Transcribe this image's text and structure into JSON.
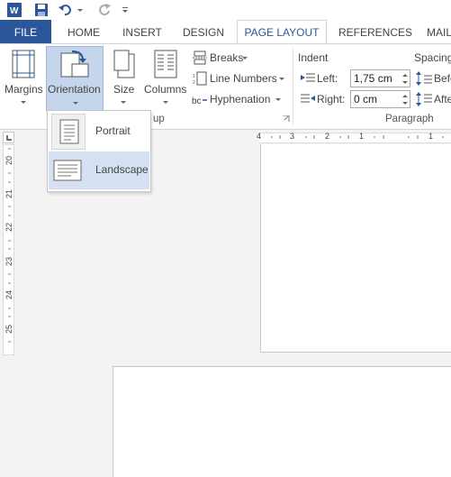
{
  "tabs": [
    "FILE",
    "HOME",
    "INSERT",
    "DESIGN",
    "PAGE LAYOUT",
    "REFERENCES",
    "MAIL"
  ],
  "ribbon": {
    "margins": "Margins",
    "orientation": "Orientation",
    "size": "Size",
    "columns": "Columns",
    "breaks": "Breaks",
    "line_numbers": "Line Numbers",
    "hyphenation": "Hyphenation",
    "page_setup_group": "up",
    "indent_title": "Indent",
    "left_label": "Left:",
    "left_value": "1,75 cm",
    "right_label": "Right:",
    "right_value": "0 cm",
    "paragraph_group": "Paragraph",
    "spacing_title": "Spacing",
    "before_label": "Befo",
    "after_label": "Afte"
  },
  "orientation_menu": {
    "portrait": "Portrait",
    "landscape": "Landscape"
  },
  "ruler": {
    "h_ticks": [
      "4",
      "3",
      "2",
      "1",
      "1"
    ],
    "v_ticks": [
      "20",
      "21",
      "22",
      "23",
      "24",
      "25"
    ]
  },
  "colors": {
    "accent": "#2b579a",
    "highlight": "#c5d5ec",
    "menu_hover": "#d5e1f2"
  }
}
